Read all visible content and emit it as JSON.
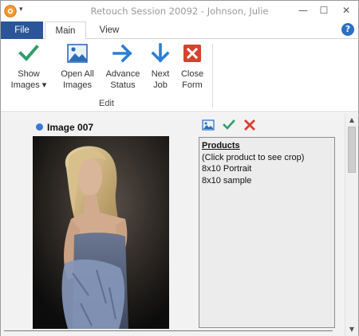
{
  "window": {
    "title": "Retouch Session 20092 - Johnson, Julie"
  },
  "titlebar": {
    "minimize": "—",
    "maximize": "☐",
    "close": "✕"
  },
  "tabs": [
    {
      "label": "File"
    },
    {
      "label": "Main"
    },
    {
      "label": "View"
    }
  ],
  "ribbon": {
    "buttons": [
      {
        "label_line1": "Show",
        "label_line2": "Images ▾",
        "icon": "checkmark-icon"
      },
      {
        "label_line1": "Open All",
        "label_line2": "Images",
        "icon": "image-icon"
      },
      {
        "label_line1": "Advance",
        "label_line2": "Status",
        "icon": "arrow-right-icon"
      },
      {
        "label_line1": "Next",
        "label_line2": "Job",
        "icon": "arrow-down-icon"
      },
      {
        "label_line1": "Close",
        "label_line2": "Form",
        "icon": "close-x-icon"
      }
    ],
    "group_label": "Edit"
  },
  "image_panel": {
    "title": "Image 007",
    "status_color": "#3a78d6"
  },
  "products": {
    "header": "Products",
    "hint": "(Click product to see crop)",
    "items": [
      "8x10 Portrait",
      "8x10 sample"
    ]
  },
  "colors": {
    "file_tab": "#2a5699",
    "check_green": "#2e9e6b",
    "arrow_blue": "#2b7fd4",
    "close_red": "#d8412f"
  }
}
